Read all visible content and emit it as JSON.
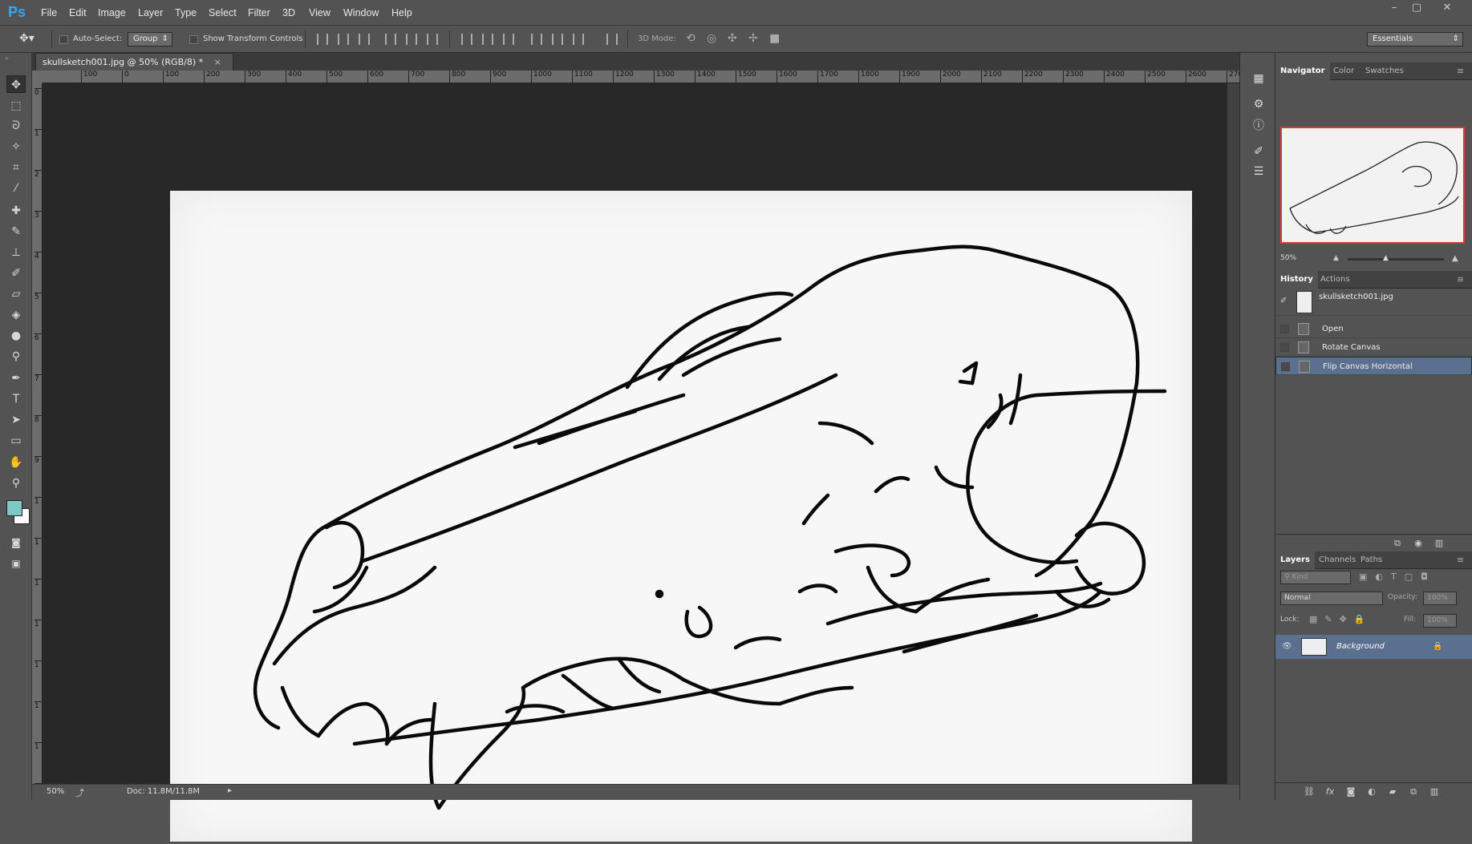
{
  "app": {
    "logo": "Ps"
  },
  "menus": [
    "File",
    "Edit",
    "Image",
    "Layer",
    "Type",
    "Select",
    "Filter",
    "3D",
    "View",
    "Window",
    "Help"
  ],
  "options": {
    "auto_select_label": "Auto-Select:",
    "auto_select_value": "Group",
    "show_transform_label": "Show Transform Controls",
    "mode_3d_label": "3D Mode:",
    "workspace": "Essentials"
  },
  "document": {
    "tab_title": "skullsketch001.jpg @ 50% (RGB/8) *",
    "close_glyph": "×"
  },
  "ruler": {
    "top_ticks": [
      "100",
      "0",
      "100",
      "200",
      "300",
      "400",
      "500",
      "600",
      "700",
      "800",
      "900",
      "1000",
      "1100",
      "1200",
      "1300",
      "1400",
      "1500",
      "1600",
      "1700",
      "1800",
      "1900",
      "2000",
      "2100",
      "2200",
      "2300",
      "2400",
      "2500",
      "2600",
      "270"
    ],
    "left_ticks": [
      "0",
      "1",
      "2",
      "3",
      "4",
      "5",
      "6",
      "7",
      "8",
      "9",
      "1",
      "1",
      "1",
      "1",
      "1",
      "1",
      "1",
      "1",
      "1"
    ]
  },
  "status": {
    "zoom": "50%",
    "doc": "Doc: 11.8M/11.8M"
  },
  "navigator": {
    "tabs": [
      "Navigator",
      "Color",
      "Swatches"
    ],
    "zoom": "50%"
  },
  "history": {
    "tabs": [
      "History",
      "Actions"
    ],
    "snapshot": "skullsketch001.jpg",
    "steps": [
      "Open",
      "Rotate Canvas",
      "Flip Canvas Horizontal"
    ]
  },
  "layers": {
    "tabs": [
      "Layers",
      "Channels",
      "Paths"
    ],
    "kind_label": "Kind",
    "blend_mode": "Normal",
    "opacity_label": "Opacity:",
    "opacity_value": "100%",
    "lock_label": "Lock:",
    "fill_label": "Fill:",
    "fill_value": "100%",
    "items": [
      {
        "name": "Background"
      }
    ]
  }
}
